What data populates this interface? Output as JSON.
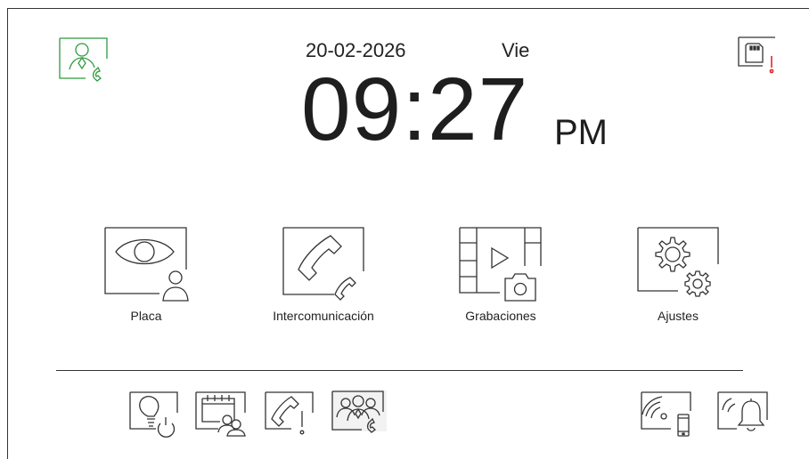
{
  "header": {
    "date": "20-02-2026",
    "day": "Vie",
    "time": "09:27",
    "ampm": "PM",
    "status_icon": "user-call-icon",
    "status_color": "#2e9b3e",
    "sd_icon": "sd-card-warning-icon",
    "warning_color": "#e0262b"
  },
  "main_menu": {
    "items": [
      {
        "label": "Placa",
        "icon": "eye-monitor-icon"
      },
      {
        "label": "Intercomunicación",
        "icon": "intercom-handset-icon"
      },
      {
        "label": "Grabaciones",
        "icon": "film-camera-icon"
      },
      {
        "label": "Ajustes",
        "icon": "gears-icon"
      }
    ]
  },
  "bottom_bar": {
    "items": [
      {
        "icon": "light-power-icon"
      },
      {
        "icon": "calendar-schedule-icon"
      },
      {
        "icon": "phone-alert-icon"
      },
      {
        "icon": "group-call-icon"
      },
      {
        "icon": "wifi-mobile-icon"
      },
      {
        "icon": "bell-ring-icon"
      }
    ]
  }
}
